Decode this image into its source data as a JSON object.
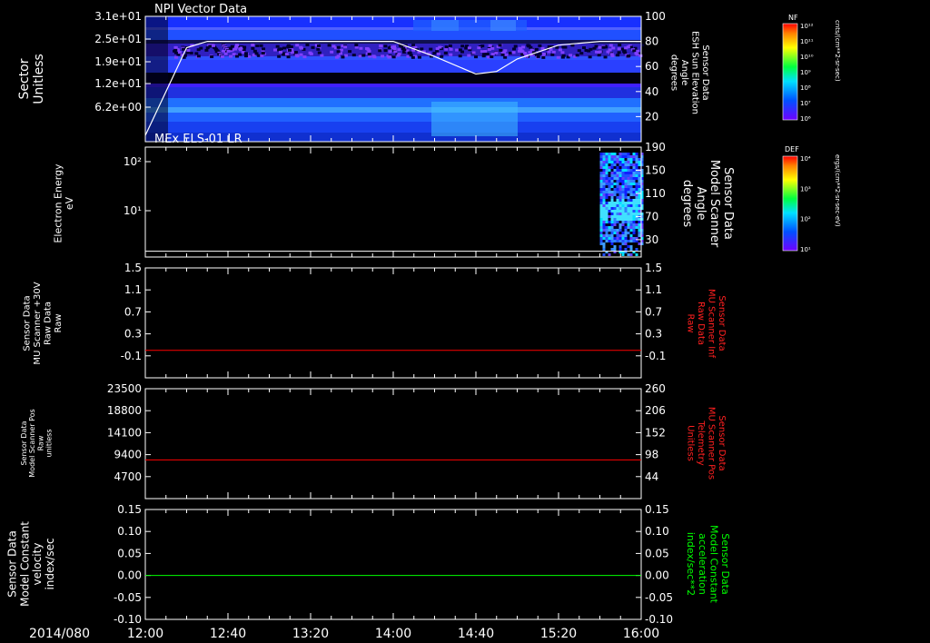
{
  "date_label": "2014/080",
  "time_ticks": [
    "12:00",
    "12:40",
    "13:20",
    "14:00",
    "14:40",
    "15:20",
    "16:00"
  ],
  "colors": {
    "background": "#000000",
    "axis": "#ffffff",
    "red_trace": "#ff0000",
    "green_trace": "#00ff00",
    "red_label": "#ff2020",
    "green_label": "#00ff00"
  },
  "chart_data": [
    {
      "type": "heatmap",
      "title": "NPI Vector Data",
      "ylabel": "Sector\nUnitless",
      "yticks": [
        "3.1e+01",
        "2.5e+01",
        "1.9e+01",
        "1.2e+01",
        "6.2e+00"
      ],
      "right_label": "Sensor Data\nESH Sun Elevation\nAngle\ndegrees",
      "right_ticks": [
        "100",
        "80",
        "60",
        "40",
        "20"
      ],
      "right_ylim": [
        0,
        100
      ],
      "colorbar": {
        "title": "NF",
        "units": "cnts/(cm**2-sr-sec)",
        "ticks": [
          "10¹²",
          "10¹¹",
          "10¹⁰",
          "10⁹",
          "10⁸",
          "10⁷",
          "10⁶"
        ]
      },
      "line": {
        "name": "ESH Sun Elevation Angle",
        "t": [
          "12:00",
          "12:10",
          "12:20",
          "12:30",
          "14:00",
          "14:20",
          "14:40",
          "14:50",
          "15:00",
          "15:20",
          "15:40",
          "16:00"
        ],
        "y": [
          5,
          40,
          75,
          80,
          80,
          68,
          54,
          56,
          66,
          77,
          80,
          80
        ]
      }
    },
    {
      "type": "heatmap",
      "title": "MEx ELS-01 LR",
      "ylabel": "Electron Energy\neV",
      "yticks": [
        "10²",
        "10¹"
      ],
      "right_label": "Sensor Data\nModel Scanner\nAngle\ndegrees",
      "right_ticks": [
        "190",
        "150",
        "110",
        "70",
        "30"
      ],
      "right_ylim": [
        0,
        190
      ],
      "colorbar": {
        "title": "DEF",
        "units": "ergs/(cm**2-sr-sec-eV)",
        "ticks": [
          "10⁴",
          "10³",
          "10²",
          "10¹"
        ]
      },
      "data_start": "15:40",
      "line": {
        "name": "Model Scanner Angle",
        "value": 10
      }
    },
    {
      "type": "line",
      "ylabel": "Sensor Data\nMU Scanner +30V\nRaw Data\nRaw",
      "yticks": [
        "1.5",
        "1.1",
        "0.7",
        "0.3",
        "-0.1"
      ],
      "ylim": [
        -0.5,
        1.5
      ],
      "right_label": "Sensor Data\nMU Scanner Inf\nRaw Data\nRaw",
      "right_ticks": [
        "1.5",
        "1.1",
        "0.7",
        "0.3",
        "-0.1"
      ],
      "series": [
        {
          "name": "MU Scanner Inf Raw Data",
          "value": 0.0
        }
      ]
    },
    {
      "type": "line",
      "ylabel": "Sensor Data\nModel Scanner Pos\nRaw\nunitless",
      "yticks": [
        "23500",
        "18800",
        "14100",
        "9400",
        "4700"
      ],
      "ylim": [
        0,
        23500
      ],
      "right_label": "Sensor Data\nMU Scanner Pos\nTelemetry\nUnitless",
      "right_ticks": [
        "260",
        "206",
        "152",
        "98",
        "44"
      ],
      "right_ylim": [
        -10,
        260
      ],
      "series": [
        {
          "name": "MU Scanner Pos Telemetry",
          "value": 85
        }
      ]
    },
    {
      "type": "line",
      "ylabel": "Sensor Data\nModel Constant\nvelocity\nindex/sec",
      "yticks": [
        "0.15",
        "0.10",
        "0.05",
        "0.00",
        "-0.05",
        "-0.10"
      ],
      "ylim": [
        -0.1,
        0.15
      ],
      "right_label": "Sensor Data\nModel Constant\nacceleration\nindex/sec**2",
      "right_ticks": [
        "0.15",
        "0.10",
        "0.05",
        "0.00",
        "-0.05",
        "-0.10"
      ],
      "series": [
        {
          "name": "Model Constant acceleration",
          "value": 0.0
        }
      ]
    }
  ]
}
